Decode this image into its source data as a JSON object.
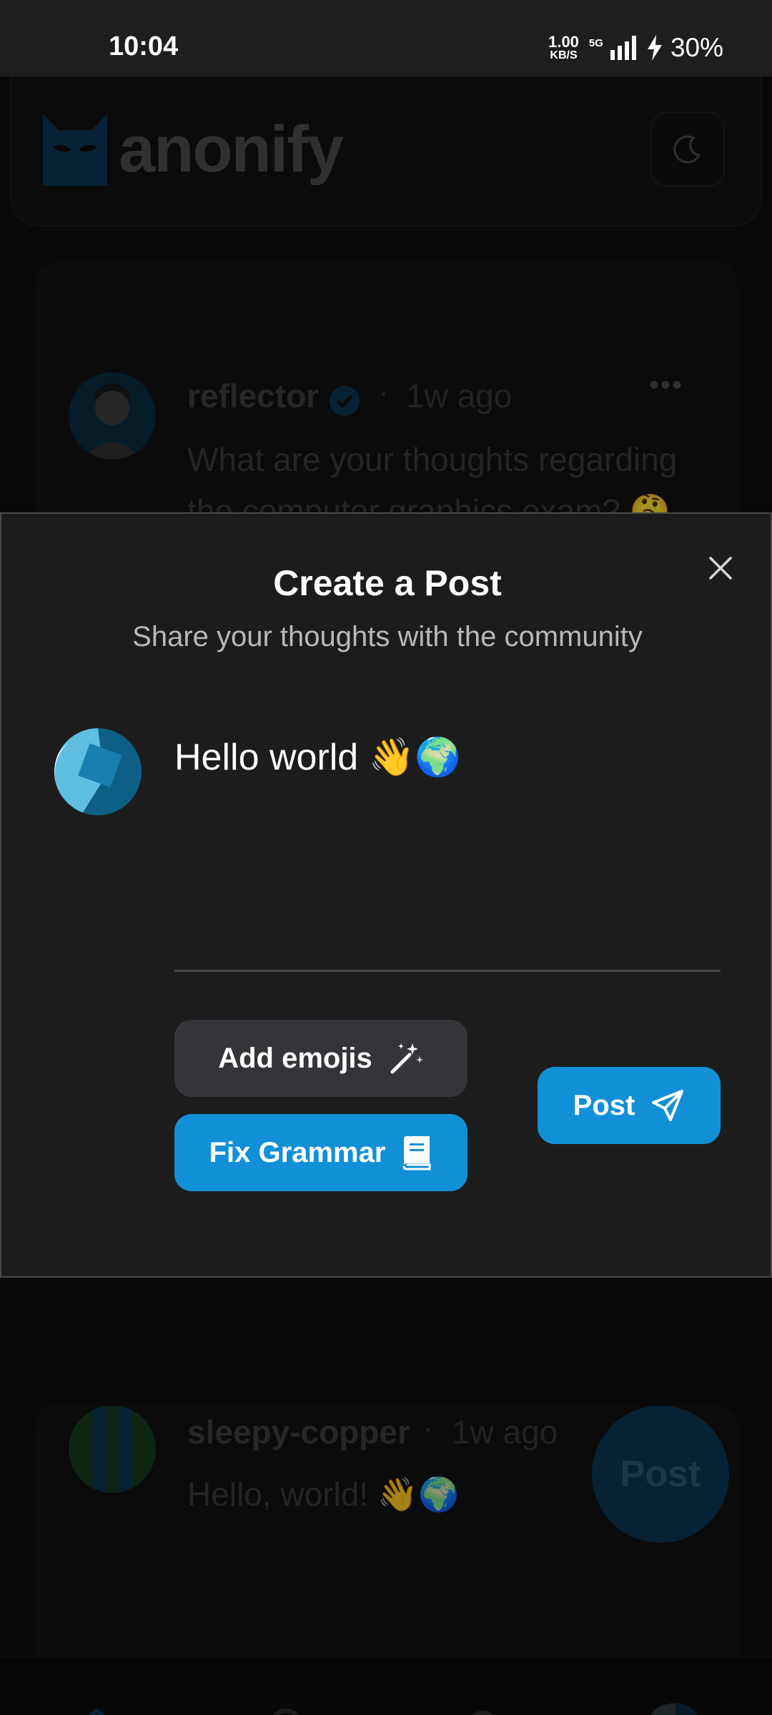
{
  "status_bar": {
    "time": "10:04",
    "net_speed_value": "1.00",
    "net_speed_unit": "KB/S",
    "network": "5G",
    "battery": "30%"
  },
  "app": {
    "name": "anonify",
    "theme_toggle_icon": "moon-icon",
    "accent_color": "#1190d8"
  },
  "feed": {
    "posts": [
      {
        "username": "reflector",
        "verified": true,
        "time": "1w ago",
        "text": "What are your thoughts regarding the computer graphics exam? 🤔"
      },
      {
        "username": "sleepy-copper",
        "time": "1w ago",
        "text": "Hello, world! 👋🌍"
      }
    ],
    "fab_label": "Post"
  },
  "modal": {
    "title": "Create a Post",
    "subtitle": "Share your thoughts with the community",
    "post_text": "Hello world 👋🌍",
    "add_emojis_label": "Add emojis",
    "fix_grammar_label": "Fix Grammar",
    "post_label": "Post"
  },
  "bottom_nav": {
    "items": [
      "home-icon",
      "search-icon",
      "bell-icon",
      "profile-avatar"
    ]
  }
}
